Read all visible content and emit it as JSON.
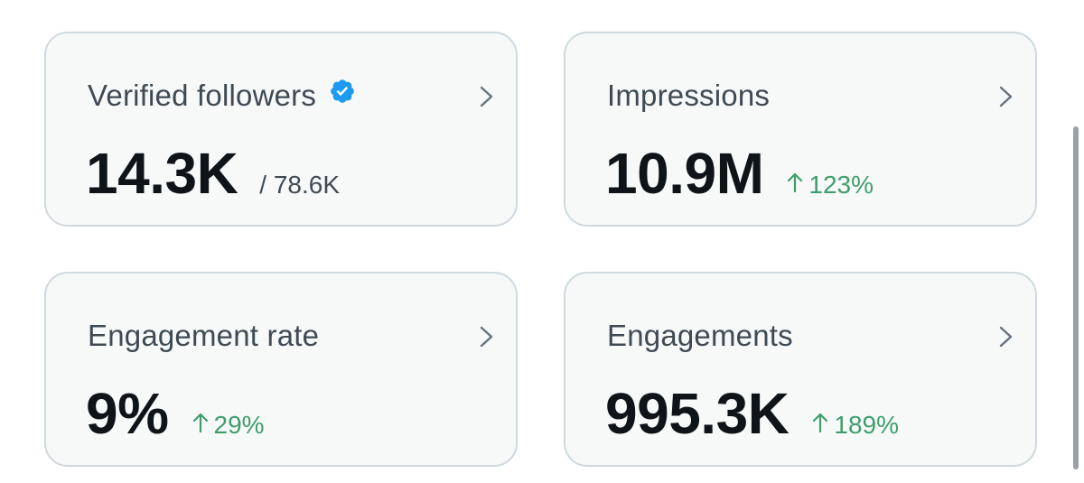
{
  "colors": {
    "card_bg": "#f7f9f9",
    "card_border": "#cfd9de",
    "title_text": "#3f4a53",
    "value_text": "#0f1419",
    "delta_positive": "#3e9e6b",
    "verified_badge": "#1d9bf0"
  },
  "cards": [
    {
      "title": "Verified followers",
      "icon": "verified-badge-icon",
      "value": "14.3K",
      "sub_total": "/ 78.6K"
    },
    {
      "title": "Impressions",
      "value": "10.9M",
      "delta": "123%",
      "delta_direction": "up"
    },
    {
      "title": "Engagement rate",
      "value": "9%",
      "delta": "29%",
      "delta_direction": "up"
    },
    {
      "title": "Engagements",
      "value": "995.3K",
      "delta": "189%",
      "delta_direction": "up"
    }
  ],
  "icons": {
    "chevron": "chevron-right-icon",
    "arrow": "arrow-up-icon"
  }
}
